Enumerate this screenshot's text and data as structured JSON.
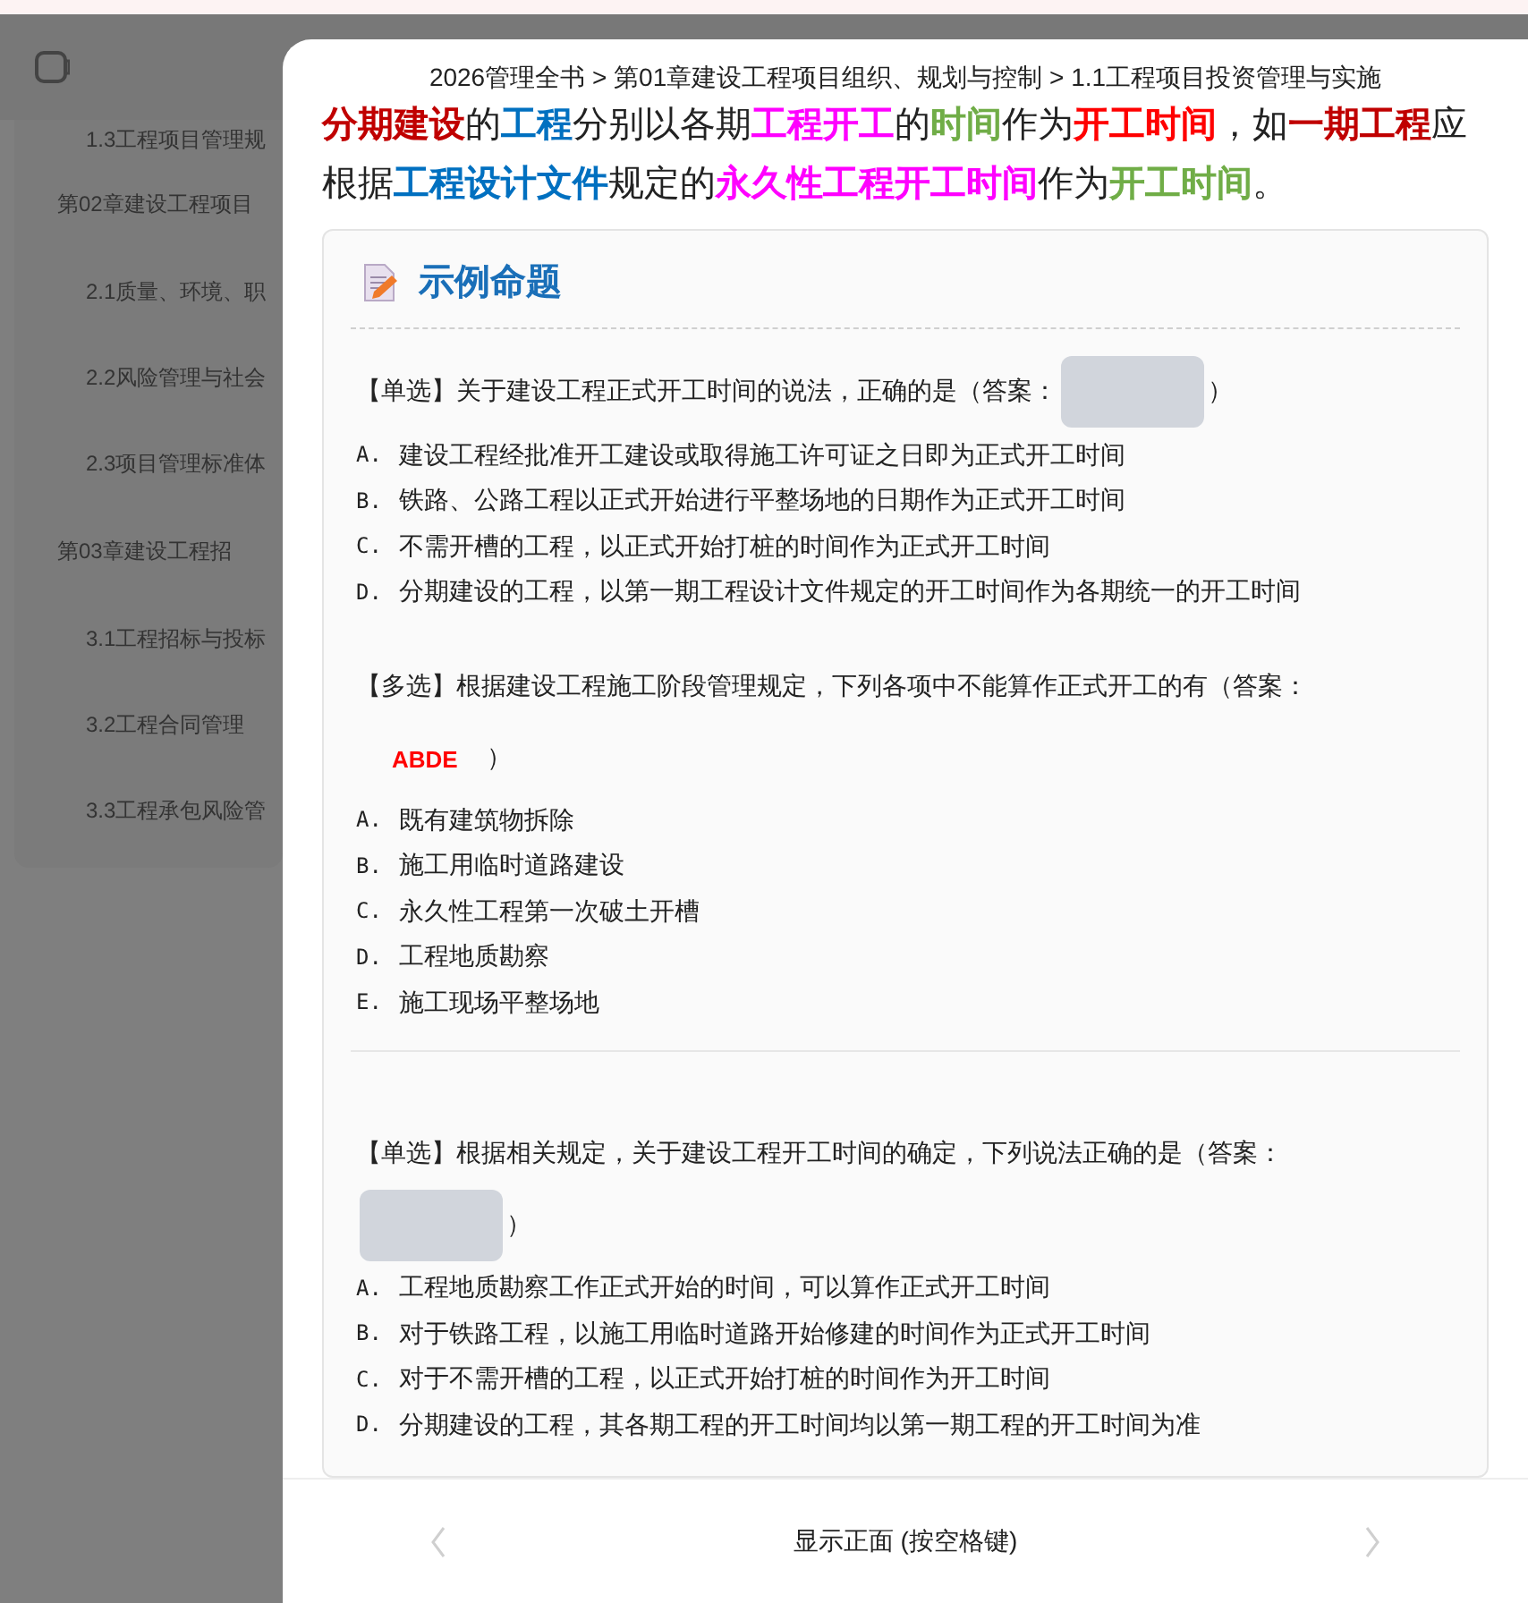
{
  "sidebar": {
    "items": [
      {
        "children": [
          {
            "label": "1.3工程项目管理规"
          }
        ]
      },
      {
        "label": "第02章建设工程项目",
        "children": [
          {
            "label": "2.1质量、环境、职"
          },
          {
            "label": "2.2风险管理与社会"
          },
          {
            "label": "2.3项目管理标准体"
          }
        ]
      },
      {
        "label": "第03章建设工程招",
        "children": [
          {
            "label": "3.1工程招标与投标"
          },
          {
            "label": "3.2工程合同管理"
          },
          {
            "label": "3.3工程承包风险管"
          }
        ]
      }
    ]
  },
  "modal": {
    "breadcrumb": "2026管理全书 > 第01章建设工程项目组织、规划与控制 > 1.1工程项目投资管理与实施",
    "paragraph": [
      {
        "text": "分期建设",
        "color": "#c00000"
      },
      {
        "text": "的"
      },
      {
        "text": "工程",
        "color": "#0070c0"
      },
      {
        "text": "分别以各期"
      },
      {
        "text": "工程开工",
        "color": "#ff00ff"
      },
      {
        "text": "的"
      },
      {
        "text": "时间",
        "color": "#70ad47"
      },
      {
        "text": "作为"
      },
      {
        "text": "开工时间",
        "color": "#ff0000"
      },
      {
        "text": "，如"
      },
      {
        "text": "一期工程",
        "color": "#c00000"
      },
      {
        "text": "应根据"
      },
      {
        "text": "工程设计文件",
        "color": "#0070c0"
      },
      {
        "text": "规定的"
      },
      {
        "text": "永久性工程开工时间",
        "color": "#ff00ff"
      },
      {
        "text": "作为"
      },
      {
        "text": "开工时间",
        "color": "#70ad47"
      },
      {
        "text": "。"
      }
    ],
    "card": {
      "title": "示例命题",
      "questions": [
        {
          "kind": "single",
          "stem": "【单选】关于建设工程正式开工时间的说法，正确的是（答案：",
          "answer": {
            "revealed": false
          },
          "close": "）",
          "divider_after": false,
          "options": [
            {
              "letter": "A.",
              "text": "建设工程经批准开工建设或取得施工许可证之日即为正式开工时间"
            },
            {
              "letter": "B.",
              "text": "铁路、公路工程以正式开始进行平整场地的日期作为正式开工时间"
            },
            {
              "letter": "C.",
              "text": "不需开槽的工程，以正式开始打桩的时间作为正式开工时间"
            },
            {
              "letter": "D.",
              "text": "分期建设的工程，以第一期工程设计文件规定的开工时间作为各期统一的开工时间"
            }
          ]
        },
        {
          "kind": "multi",
          "stem": "【多选】根据建设工程施工阶段管理规定，下列各项中不能算作正式开工的有（答案：",
          "answer": {
            "revealed": true,
            "text": "ABDE"
          },
          "close": "）",
          "divider_after": true,
          "options": [
            {
              "letter": "A.",
              "text": "既有建筑物拆除"
            },
            {
              "letter": "B.",
              "text": "施工用临时道路建设"
            },
            {
              "letter": "C.",
              "text": "永久性工程第一次破土开槽"
            },
            {
              "letter": "D.",
              "text": "工程地质勘察"
            },
            {
              "letter": "E.",
              "text": "施工现场平整场地"
            }
          ]
        },
        {
          "kind": "single",
          "stem": "【单选】根据相关规定，关于建设工程开工时间的确定，下列说法正确的是（答案：",
          "answer": {
            "revealed": false
          },
          "close": "）",
          "divider_after": false,
          "options": [
            {
              "letter": "A.",
              "text": "工程地质勘察工作正式开始的时间，可以算作正式开工时间"
            },
            {
              "letter": "B.",
              "text": "对于铁路工程，以施工用临时道路开始修建的时间作为正式开工时间"
            },
            {
              "letter": "C.",
              "text": "对于不需开槽的工程，以正式开始打桩的时间作为开工时间"
            },
            {
              "letter": "D.",
              "text": "分期建设的工程，其各期工程的开工时间均以第一期工程的开工时间为准"
            }
          ]
        }
      ]
    },
    "footer": {
      "label": "显示正面 (按空格键)",
      "prev_disabled": true,
      "next_disabled": true
    }
  }
}
